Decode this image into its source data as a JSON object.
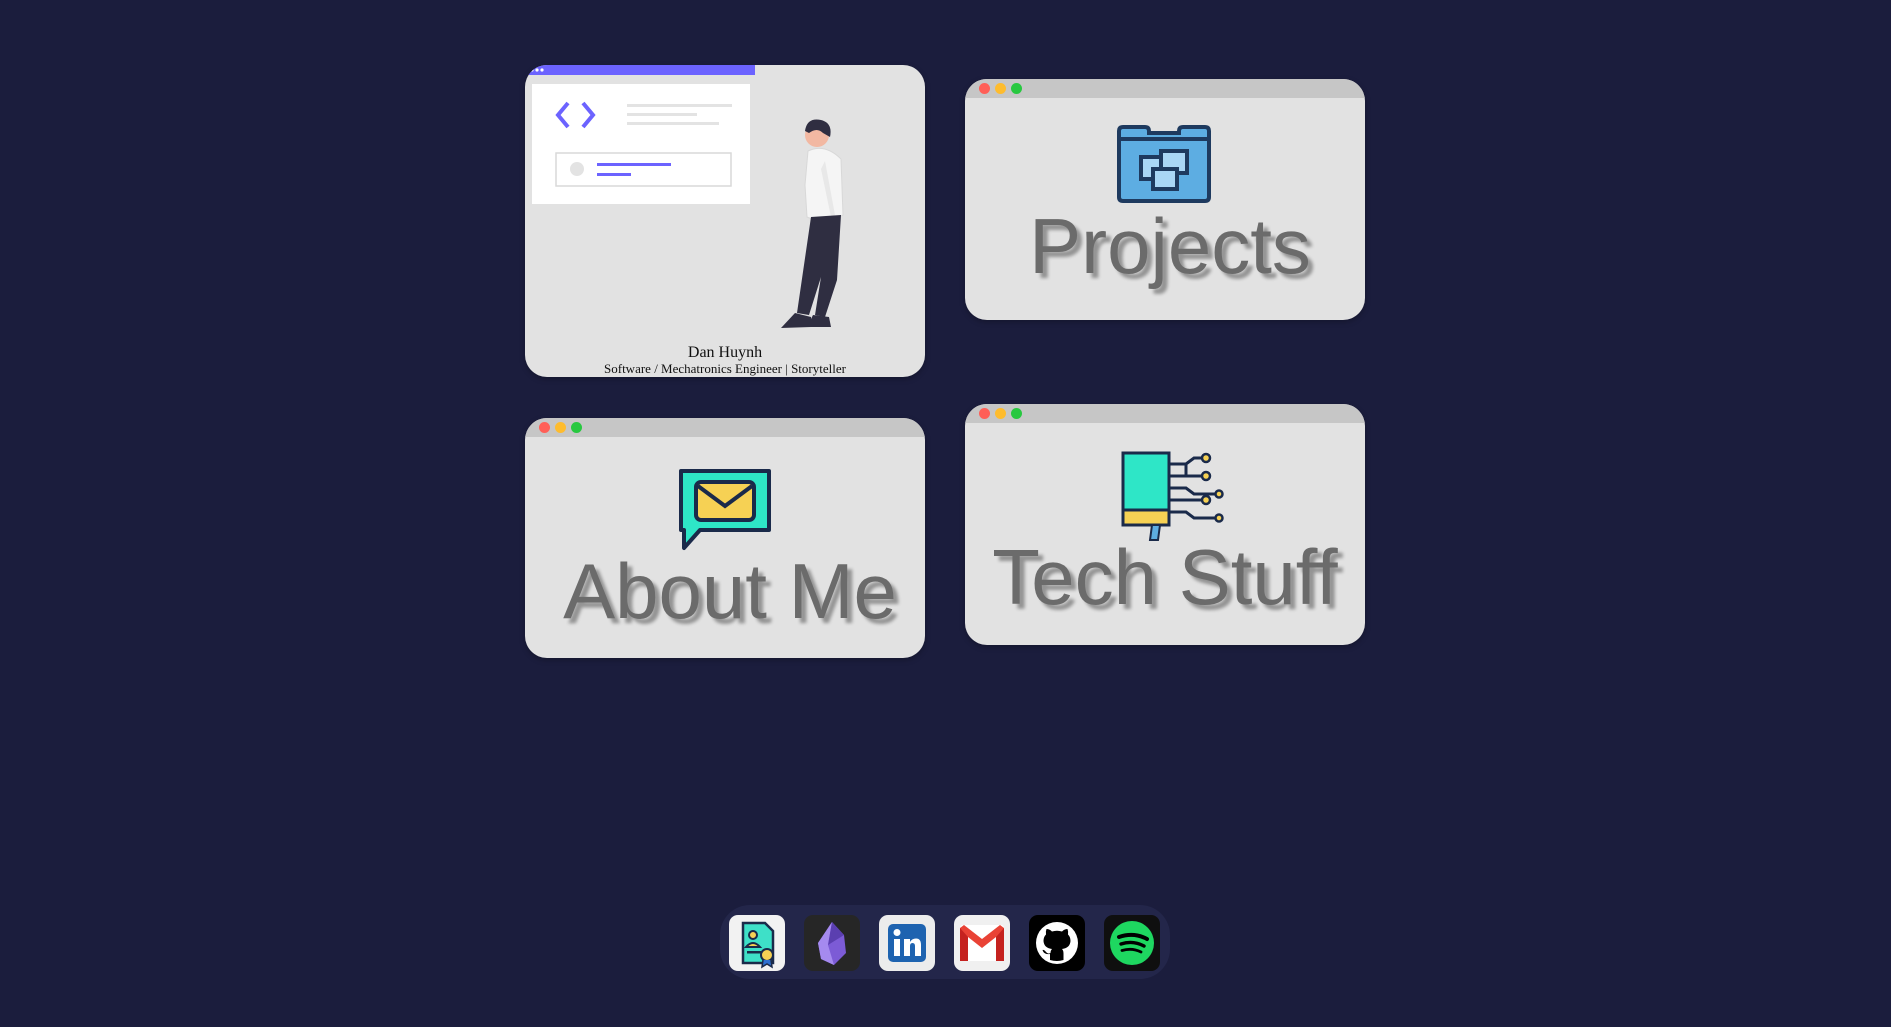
{
  "hero": {
    "name": "Dan Huynh",
    "subtitle": "Software / Mechatronics Engineer | Storyteller"
  },
  "cards": {
    "projects": {
      "label": "Projects",
      "icon": "folder-windows-icon"
    },
    "about": {
      "label": "About Me",
      "icon": "mail-chat-icon"
    },
    "tech": {
      "label": "Tech Stuff",
      "icon": "circuit-device-icon"
    }
  },
  "dock": {
    "items": [
      {
        "name": "resume",
        "icon": "certificate-icon"
      },
      {
        "name": "obsidian",
        "icon": "obsidian-icon"
      },
      {
        "name": "linkedin",
        "icon": "linkedin-icon"
      },
      {
        "name": "gmail",
        "icon": "gmail-icon"
      },
      {
        "name": "github",
        "icon": "github-icon"
      },
      {
        "name": "spotify",
        "icon": "spotify-icon"
      }
    ]
  },
  "colors": {
    "background": "#1b1d3d",
    "card": "#e2e2e2",
    "accent": "#6c63ff",
    "label": "#6b6b6b"
  }
}
